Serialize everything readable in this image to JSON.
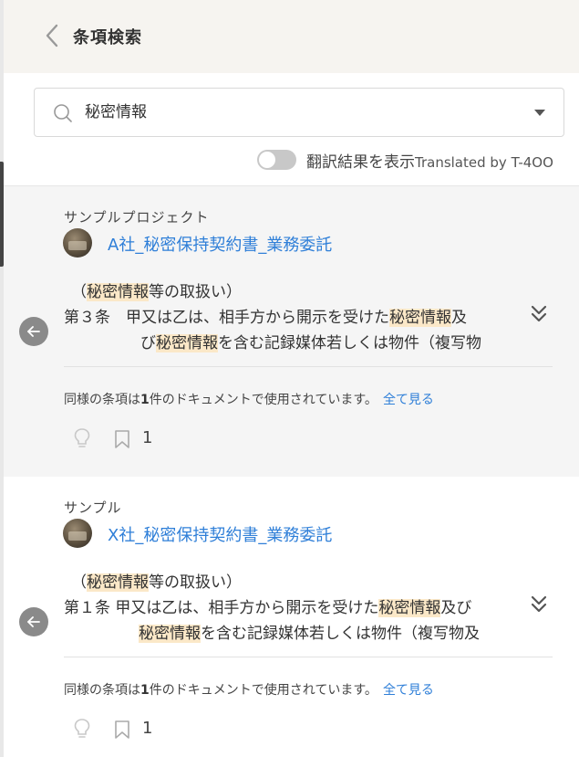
{
  "header": {
    "title": "条項検索"
  },
  "search": {
    "value": "秘密情報"
  },
  "toggle": {
    "label": "翻訳結果を表示",
    "label_tr": "Translated by T-4OO",
    "on": false
  },
  "results": [
    {
      "project": "サンプルプロジェクト",
      "doc_title": "A社_秘密保持契約書_業務委託",
      "clause_heading": {
        "pre": "（",
        "hl": "秘密情報",
        "post": "等の取扱い）"
      },
      "line1": {
        "a": "第３条　甲又は乙は、相手方から開示を受けた",
        "hl": "秘密情報",
        "b": "及"
      },
      "line2": {
        "a": "び",
        "hl": "秘密情報",
        "b": "を含む記録媒体若しくは物件（複写物"
      },
      "usage": {
        "pre": "同様の条項は",
        "count": "1",
        "post": "件のドキュメントで使用されています。",
        "link": "全て見る"
      },
      "bookmark_count": "1"
    },
    {
      "project": "サンプル",
      "doc_title": "X社_秘密保持契約書_業務委託",
      "clause_heading": {
        "pre": "（",
        "hl": "秘密情報",
        "post": "等の取扱い）"
      },
      "line1": {
        "a": "第１条 甲又は乙は、相手方から開示を受けた",
        "hl": "秘密情報",
        "b": "及び"
      },
      "line2": {
        "a": "",
        "hl": "秘密情報",
        "b": "を含む記録媒体若しくは物件（複写物及"
      },
      "usage": {
        "pre": "同様の条項は",
        "count": "1",
        "post": "件のドキュメントで使用されています。",
        "link": "全て見る"
      },
      "bookmark_count": "1"
    }
  ],
  "icons": {
    "back": "chevron-left-icon",
    "search": "search-icon",
    "dropdown": "caret-down-icon",
    "apply": "arrow-left-circle-icon",
    "expand": "double-chevron-down-icon",
    "bulb": "lightbulb-icon",
    "bookmark": "bookmark-icon"
  },
  "colors": {
    "link": "#2f7fd8",
    "highlight": "#fbe8c8",
    "header_bg": "#f6f4f0",
    "card_active_bg": "#f5f5f5"
  }
}
